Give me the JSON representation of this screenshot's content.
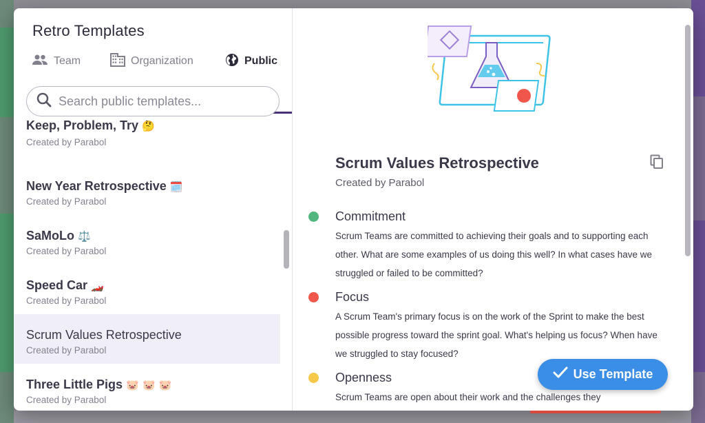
{
  "colors": {
    "accent": "#493273",
    "primary_button": "#3a8ee6",
    "commitment": "#52b67e",
    "focus": "#f0574a",
    "openness": "#f6c94a"
  },
  "modal": {
    "title": "Retro Templates",
    "tabs": [
      {
        "label": "Team",
        "icon": "people-icon",
        "active": false
      },
      {
        "label": "Organization",
        "icon": "building-icon",
        "active": false
      },
      {
        "label": "Public",
        "icon": "globe-icon",
        "active": true
      }
    ],
    "search": {
      "placeholder": "Search public templates...",
      "value": ""
    }
  },
  "templates": [
    {
      "title": "Keep, Problem, Try",
      "emoji": "🤔",
      "creator": "Created by Parabol",
      "selected": false
    },
    {
      "title": "New Year Retrospective",
      "emoji": "🗓️",
      "creator": "Created by Parabol",
      "selected": false
    },
    {
      "title": "SaMoLo",
      "emoji": "⚖️",
      "creator": "Created by Parabol",
      "selected": false
    },
    {
      "title": "Speed Car",
      "emoji": "🏎️",
      "creator": "Created by Parabol",
      "selected": false
    },
    {
      "title": "Scrum Values Retrospective",
      "emoji": "",
      "creator": "Created by Parabol",
      "selected": true
    },
    {
      "title": "Three Little Pigs",
      "emoji": "🐷 🐷 🐷",
      "creator": "Created by Parabol",
      "selected": false
    }
  ],
  "detail": {
    "title": "Scrum Values Retrospective",
    "creator": "Created by Parabol",
    "prompts": [
      {
        "title": "Commitment",
        "description": "Scrum Teams are committed to achieving their goals and to supporting each other. What are some examples of us doing this well? In what cases have we struggled or failed to be committed?"
      },
      {
        "title": "Focus",
        "description": "A Scrum Team's primary focus is on the work of the Sprint to make the best possible progress toward the sprint goal. What's helping us focus? When have we struggled to stay focused?"
      },
      {
        "title": "Openness",
        "description": "Scrum Teams are open about their work and the challenges they"
      }
    ],
    "use_button_label": "Use Template"
  }
}
